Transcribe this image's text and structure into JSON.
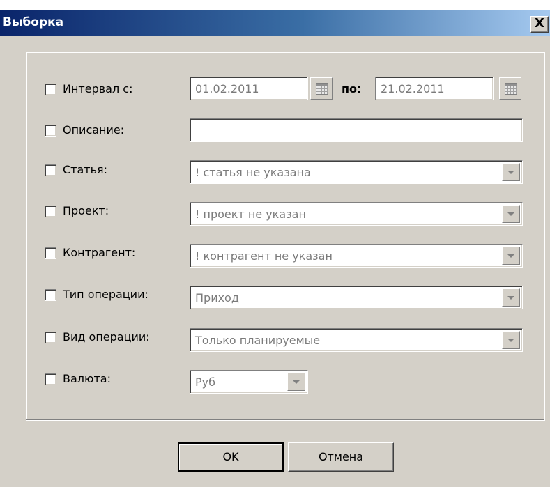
{
  "window": {
    "title": "Выборка",
    "close_glyph": "X"
  },
  "interval": {
    "label": "Интервал с:",
    "from": "01.02.2011",
    "to_label": "по:",
    "to": "21.02.2011"
  },
  "description": {
    "label": "Описание:",
    "value": ""
  },
  "article": {
    "label": "Статья:",
    "value": "! статья не указана"
  },
  "project": {
    "label": "Проект:",
    "value": "! проект не указан"
  },
  "counterparty": {
    "label": "Контрагент:",
    "value": "! контрагент не указан"
  },
  "op_type": {
    "label": "Тип операции:",
    "value": "Приход"
  },
  "op_kind": {
    "label": "Вид операции:",
    "value": "Только планируемые"
  },
  "currency": {
    "label": "Валюта:",
    "value": "Руб"
  },
  "buttons": {
    "ok": "OK",
    "cancel": "Отмена"
  },
  "icons": {
    "calendar": "calendar-icon",
    "dropdown": "chevron-down-icon",
    "close": "close-icon"
  }
}
